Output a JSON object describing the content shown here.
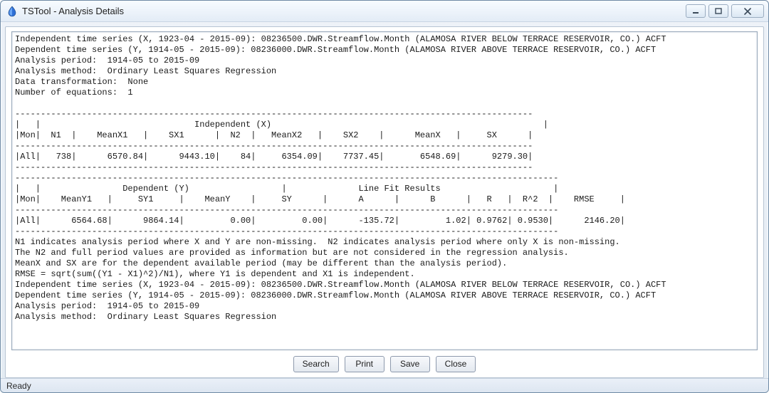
{
  "window": {
    "title": "TSTool - Analysis Details"
  },
  "buttons": {
    "search": "Search",
    "print": "Print",
    "save": "Save",
    "close": "Close"
  },
  "status": "Ready",
  "report": {
    "independent_ts": "Independent time series (X, 1923-04 - 2015-09): 08236500.DWR.Streamflow.Month (ALAMOSA RIVER BELOW TERRACE RESERVOIR, CO.) ACFT",
    "dependent_ts": "Dependent time series (Y, 1914-05 - 2015-09): 08236000.DWR.Streamflow.Month (ALAMOSA RIVER ABOVE TERRACE RESERVOIR, CO.) ACFT",
    "analysis_period": "Analysis period:  1914-05 to 2015-09",
    "analysis_method": "Analysis method:  Ordinary Least Squares Regression",
    "data_transformation": "Data transformation:  None",
    "num_equations": "Number of equations:  1",
    "section1_title": "Independent (X)",
    "table1_hdr": "|Mon|  N1  |    MeanX1   |    SX1      |  N2  |   MeanX2   |    SX2    |      MeanX   |     SX      |",
    "table1_row": "|All|   738|      6570.84|      9443.10|    84|     6354.09|    7737.45|       6548.69|      9279.30|",
    "section2a_title": "Dependent (Y)",
    "section2b_title": "Line Fit Results",
    "table2_hdr": "|Mon|    MeanY1   |     SY1     |    MeanY    |     SY      |      A      |      B      |   R   |  R^2  |    RMSE     |",
    "table2_row": "|All|      6564.68|      9864.14|         0.00|         0.00|      -135.72|         1.02| 0.9762| 0.9530|      2146.20|",
    "note1": "N1 indicates analysis period where X and Y are non-missing.  N2 indicates analysis period where only X is non-missing.",
    "note2": "The N2 and full period values are provided as information but are not considered in the regression analysis.",
    "note3": "MeanX and SX are for the dependent available period (may be different than the analysis period).",
    "note4": "RMSE = sqrt(sum((Y1 - X1)^2)/N1), where Y1 is dependent and X1 is independent."
  }
}
